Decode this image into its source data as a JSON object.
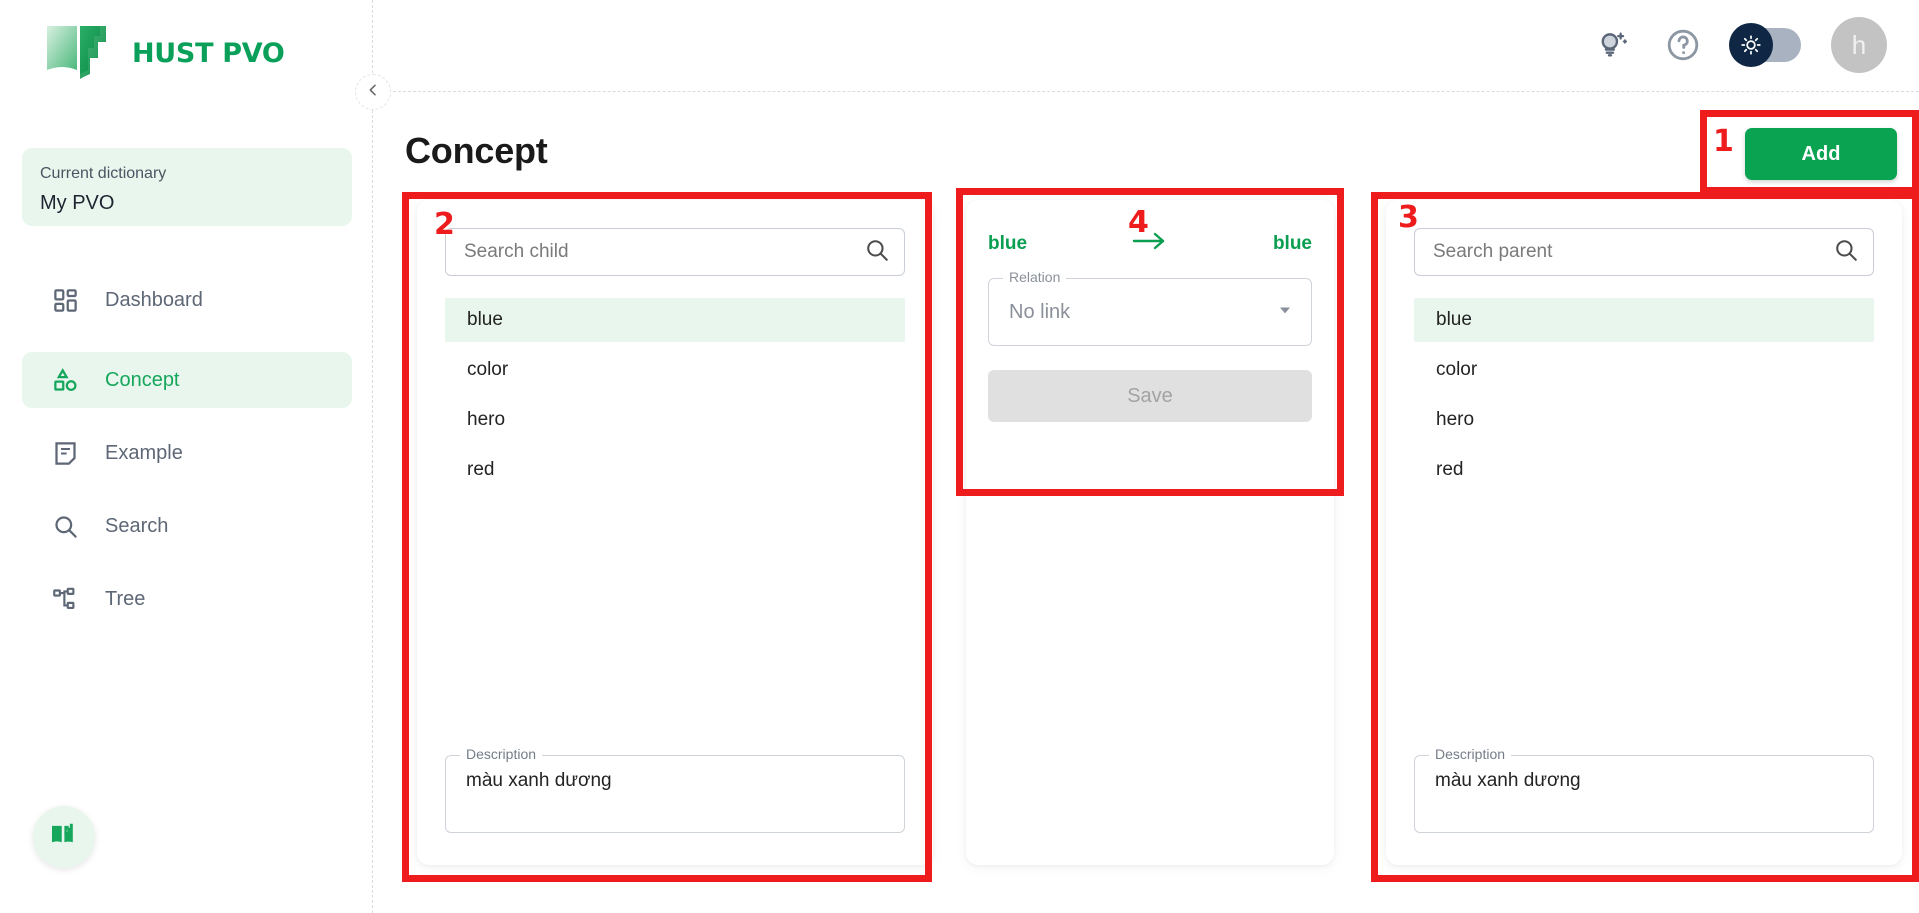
{
  "brand": {
    "name": "HUST PVO",
    "logo_icon": "open-book-icon",
    "green": "#0aa05a"
  },
  "sidebar": {
    "dictionary": {
      "label": "Current dictionary",
      "value": "My PVO"
    },
    "items": [
      {
        "label": "Dashboard",
        "icon": "dashboard-grid-icon",
        "active": false
      },
      {
        "label": "Concept",
        "icon": "shapes-icon",
        "active": true
      },
      {
        "label": "Example",
        "icon": "note-icon",
        "active": false
      },
      {
        "label": "Search",
        "icon": "magnifier-icon",
        "active": false
      },
      {
        "label": "Tree",
        "icon": "hierarchy-tree-icon",
        "active": false
      }
    ],
    "fab_icon": "open-book-icon",
    "collapse_icon": "chevron-left-icon"
  },
  "header": {
    "icons": [
      {
        "name": "lightbulb-sparkle-icon"
      },
      {
        "name": "help-circle-icon"
      }
    ],
    "theme_toggle": {
      "icon": "sun-icon",
      "state": "dark",
      "on": false
    },
    "avatar": {
      "initial": "h"
    }
  },
  "page": {
    "title": "Concept",
    "add_label": "Add"
  },
  "child_panel": {
    "search_placeholder": "Search child",
    "search_value": "",
    "search_icon": "magnifier-icon",
    "items": [
      {
        "label": "blue",
        "selected": true
      },
      {
        "label": "color",
        "selected": false
      },
      {
        "label": "hero",
        "selected": false
      },
      {
        "label": "red",
        "selected": false
      }
    ],
    "description_label": "Description",
    "description_value": "màu xanh dương"
  },
  "parent_panel": {
    "search_placeholder": "Search parent",
    "search_value": "",
    "search_icon": "magnifier-icon",
    "items": [
      {
        "label": "blue",
        "selected": true
      },
      {
        "label": "color",
        "selected": false
      },
      {
        "label": "hero",
        "selected": false
      },
      {
        "label": "red",
        "selected": false
      }
    ],
    "description_label": "Description",
    "description_value": "màu xanh dương"
  },
  "relation_panel": {
    "left_word": "blue",
    "arrow_icon": "arrow-right-icon",
    "right_word": "blue",
    "relation_label": "Relation",
    "relation_value": "No link",
    "dropdown_icon": "chevron-down-icon",
    "save_label": "Save"
  },
  "annotations": [
    {
      "id": "1",
      "number": "1"
    },
    {
      "id": "2",
      "number": "2"
    },
    {
      "id": "3",
      "number": "3"
    },
    {
      "id": "4",
      "number": "4"
    }
  ]
}
